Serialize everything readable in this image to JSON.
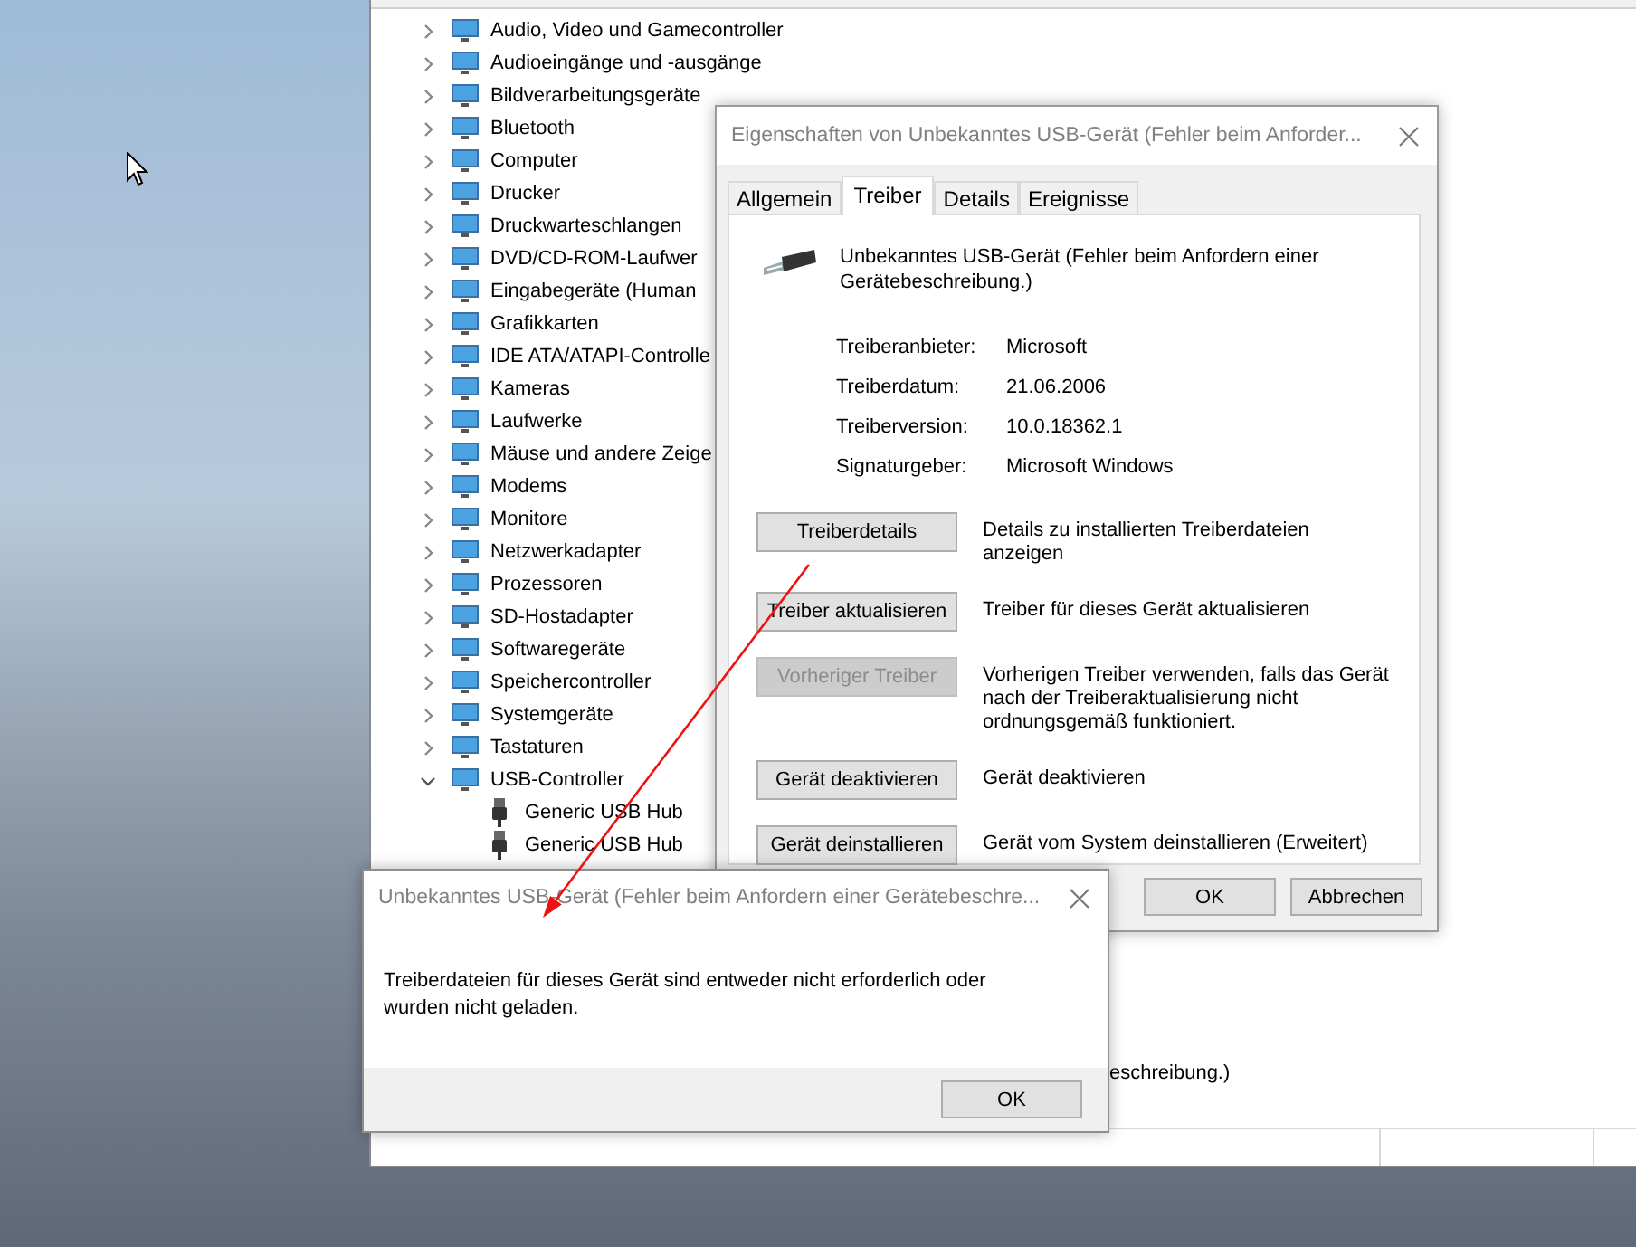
{
  "device_manager": {
    "tree": [
      {
        "label": "Audio, Video und Gamecontroller",
        "expanded": false
      },
      {
        "label": "Audioeingänge und -ausgänge",
        "expanded": false
      },
      {
        "label": "Bildverarbeitungsgeräte",
        "expanded": false
      },
      {
        "label": "Bluetooth",
        "expanded": false
      },
      {
        "label": "Computer",
        "expanded": false
      },
      {
        "label": "Drucker",
        "expanded": false
      },
      {
        "label": "Druckwarteschlangen",
        "expanded": false
      },
      {
        "label": "DVD/CD-ROM-Laufwer",
        "expanded": false
      },
      {
        "label": "Eingabegeräte (Human",
        "expanded": false
      },
      {
        "label": "Grafikkarten",
        "expanded": false
      },
      {
        "label": "IDE ATA/ATAPI-Controlle",
        "expanded": false
      },
      {
        "label": "Kameras",
        "expanded": false
      },
      {
        "label": "Laufwerke",
        "expanded": false
      },
      {
        "label": "Mäuse und andere Zeige",
        "expanded": false
      },
      {
        "label": "Modems",
        "expanded": false
      },
      {
        "label": "Monitore",
        "expanded": false
      },
      {
        "label": "Netzwerkadapter",
        "expanded": false
      },
      {
        "label": "Prozessoren",
        "expanded": false
      },
      {
        "label": "SD-Hostadapter",
        "expanded": false
      },
      {
        "label": "Softwaregeräte",
        "expanded": false
      },
      {
        "label": "Speichercontroller",
        "expanded": false
      },
      {
        "label": "Systemgeräte",
        "expanded": false
      },
      {
        "label": "Tastaturen",
        "expanded": false
      },
      {
        "label": "USB-Controller",
        "expanded": true,
        "children": [
          {
            "label": "Generic USB Hub"
          },
          {
            "label": "Generic USB Hub"
          }
        ]
      }
    ],
    "covered_row": "eschreibung.)"
  },
  "properties_dialog": {
    "title": "Eigenschaften von Unbekanntes USB-Gerät (Fehler beim Anforder...",
    "tabs": [
      {
        "label": "Allgemein",
        "selected": false
      },
      {
        "label": "Treiber",
        "selected": true
      },
      {
        "label": "Details",
        "selected": false
      },
      {
        "label": "Ereignisse",
        "selected": false
      }
    ],
    "device_name": "Unbekanntes USB-Gerät (Fehler beim Anfordern einer Gerätebeschreibung.)",
    "info": [
      {
        "label": "Treiberanbieter:",
        "value": "Microsoft"
      },
      {
        "label": "Treiberdatum:",
        "value": "21.06.2006"
      },
      {
        "label": "Treiberversion:",
        "value": "10.0.18362.1"
      },
      {
        "label": "Signaturgeber:",
        "value": "Microsoft Windows"
      }
    ],
    "actions": [
      {
        "button": "Treiberdetails",
        "disabled": false,
        "description": "Details zu installierten Treiberdateien anzeigen"
      },
      {
        "button": "Treiber aktualisieren",
        "disabled": false,
        "description": "Treiber für dieses Gerät aktualisieren"
      },
      {
        "button": "Vorheriger Treiber",
        "disabled": true,
        "description": "Vorherigen Treiber verwenden, falls das Gerät nach der Treiberaktualisierung nicht ordnungsgemäß funktioniert."
      },
      {
        "button": "Gerät deaktivieren",
        "disabled": false,
        "description": "Gerät deaktivieren"
      },
      {
        "button": "Gerät deinstallieren",
        "disabled": false,
        "description": "Gerät vom System deinstallieren (Erweitert)"
      }
    ],
    "buttons": [
      "OK",
      "Abbrechen"
    ]
  },
  "message_box": {
    "title": "Unbekanntes USB-Gerät (Fehler beim Anfordern einer Gerätebeschre...",
    "message": "Treiberdateien für dieses Gerät sind entweder nicht erforderlich oder wurden nicht geladen.",
    "buttons": [
      "OK"
    ]
  }
}
